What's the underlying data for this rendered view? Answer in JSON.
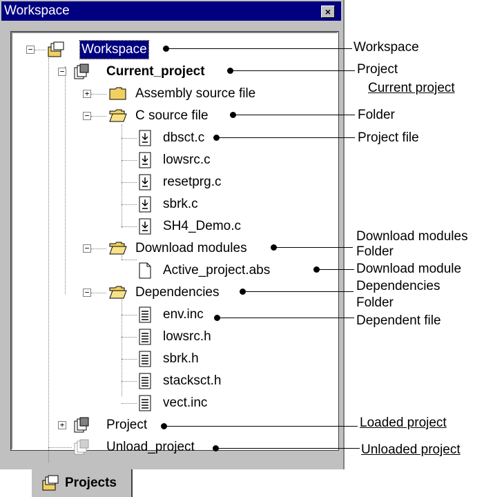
{
  "window": {
    "title": "Workspace",
    "close_label": "×"
  },
  "tab": {
    "label": "Projects"
  },
  "tree": {
    "workspace": "Workspace",
    "current_project": "Current_project",
    "assembly": "Assembly source file",
    "c_source": "C source file",
    "c_files": [
      "dbsct.c",
      "lowsrc.c",
      "resetprg.c",
      "sbrk.c",
      "SH4_Demo.c"
    ],
    "download_modules": "Download modules",
    "download_file": "Active_project.abs",
    "dependencies": "Dependencies",
    "dep_files": [
      "env.inc",
      "lowsrc.h",
      "sbrk.h",
      "stacksct.h",
      "vect.inc"
    ],
    "project": "Project",
    "unload_project": "Unload_project"
  },
  "annotations": {
    "workspace": "Workspace",
    "project": "Project",
    "current_project": "Current project",
    "folder": "Folder",
    "project_file": "Project file",
    "download_modules_folder_1": "Download modules",
    "download_modules_folder_2": "Folder",
    "download_module": "Download module",
    "dependencies_folder_1": "Dependencies",
    "dependencies_folder_2": "Folder",
    "dependent_file": "Dependent file",
    "loaded_project": "Loaded project",
    "unloaded_project": "Unloaded project"
  },
  "colors": {
    "titlebar": "#000080",
    "selection": "#000080",
    "window": "#c0c0c0",
    "folder": "#f0d060"
  }
}
